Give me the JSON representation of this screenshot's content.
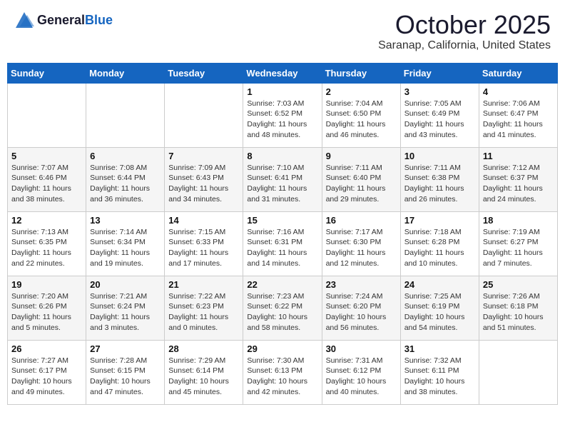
{
  "header": {
    "logo_general": "General",
    "logo_blue": "Blue",
    "month": "October 2025",
    "location": "Saranap, California, United States"
  },
  "weekdays": [
    "Sunday",
    "Monday",
    "Tuesday",
    "Wednesday",
    "Thursday",
    "Friday",
    "Saturday"
  ],
  "weeks": [
    [
      {
        "day": "",
        "info": ""
      },
      {
        "day": "",
        "info": ""
      },
      {
        "day": "",
        "info": ""
      },
      {
        "day": "1",
        "info": "Sunrise: 7:03 AM\nSunset: 6:52 PM\nDaylight: 11 hours\nand 48 minutes."
      },
      {
        "day": "2",
        "info": "Sunrise: 7:04 AM\nSunset: 6:50 PM\nDaylight: 11 hours\nand 46 minutes."
      },
      {
        "day": "3",
        "info": "Sunrise: 7:05 AM\nSunset: 6:49 PM\nDaylight: 11 hours\nand 43 minutes."
      },
      {
        "day": "4",
        "info": "Sunrise: 7:06 AM\nSunset: 6:47 PM\nDaylight: 11 hours\nand 41 minutes."
      }
    ],
    [
      {
        "day": "5",
        "info": "Sunrise: 7:07 AM\nSunset: 6:46 PM\nDaylight: 11 hours\nand 38 minutes."
      },
      {
        "day": "6",
        "info": "Sunrise: 7:08 AM\nSunset: 6:44 PM\nDaylight: 11 hours\nand 36 minutes."
      },
      {
        "day": "7",
        "info": "Sunrise: 7:09 AM\nSunset: 6:43 PM\nDaylight: 11 hours\nand 34 minutes."
      },
      {
        "day": "8",
        "info": "Sunrise: 7:10 AM\nSunset: 6:41 PM\nDaylight: 11 hours\nand 31 minutes."
      },
      {
        "day": "9",
        "info": "Sunrise: 7:11 AM\nSunset: 6:40 PM\nDaylight: 11 hours\nand 29 minutes."
      },
      {
        "day": "10",
        "info": "Sunrise: 7:11 AM\nSunset: 6:38 PM\nDaylight: 11 hours\nand 26 minutes."
      },
      {
        "day": "11",
        "info": "Sunrise: 7:12 AM\nSunset: 6:37 PM\nDaylight: 11 hours\nand 24 minutes."
      }
    ],
    [
      {
        "day": "12",
        "info": "Sunrise: 7:13 AM\nSunset: 6:35 PM\nDaylight: 11 hours\nand 22 minutes."
      },
      {
        "day": "13",
        "info": "Sunrise: 7:14 AM\nSunset: 6:34 PM\nDaylight: 11 hours\nand 19 minutes."
      },
      {
        "day": "14",
        "info": "Sunrise: 7:15 AM\nSunset: 6:33 PM\nDaylight: 11 hours\nand 17 minutes."
      },
      {
        "day": "15",
        "info": "Sunrise: 7:16 AM\nSunset: 6:31 PM\nDaylight: 11 hours\nand 14 minutes."
      },
      {
        "day": "16",
        "info": "Sunrise: 7:17 AM\nSunset: 6:30 PM\nDaylight: 11 hours\nand 12 minutes."
      },
      {
        "day": "17",
        "info": "Sunrise: 7:18 AM\nSunset: 6:28 PM\nDaylight: 11 hours\nand 10 minutes."
      },
      {
        "day": "18",
        "info": "Sunrise: 7:19 AM\nSunset: 6:27 PM\nDaylight: 11 hours\nand 7 minutes."
      }
    ],
    [
      {
        "day": "19",
        "info": "Sunrise: 7:20 AM\nSunset: 6:26 PM\nDaylight: 11 hours\nand 5 minutes."
      },
      {
        "day": "20",
        "info": "Sunrise: 7:21 AM\nSunset: 6:24 PM\nDaylight: 11 hours\nand 3 minutes."
      },
      {
        "day": "21",
        "info": "Sunrise: 7:22 AM\nSunset: 6:23 PM\nDaylight: 11 hours\nand 0 minutes."
      },
      {
        "day": "22",
        "info": "Sunrise: 7:23 AM\nSunset: 6:22 PM\nDaylight: 10 hours\nand 58 minutes."
      },
      {
        "day": "23",
        "info": "Sunrise: 7:24 AM\nSunset: 6:20 PM\nDaylight: 10 hours\nand 56 minutes."
      },
      {
        "day": "24",
        "info": "Sunrise: 7:25 AM\nSunset: 6:19 PM\nDaylight: 10 hours\nand 54 minutes."
      },
      {
        "day": "25",
        "info": "Sunrise: 7:26 AM\nSunset: 6:18 PM\nDaylight: 10 hours\nand 51 minutes."
      }
    ],
    [
      {
        "day": "26",
        "info": "Sunrise: 7:27 AM\nSunset: 6:17 PM\nDaylight: 10 hours\nand 49 minutes."
      },
      {
        "day": "27",
        "info": "Sunrise: 7:28 AM\nSunset: 6:15 PM\nDaylight: 10 hours\nand 47 minutes."
      },
      {
        "day": "28",
        "info": "Sunrise: 7:29 AM\nSunset: 6:14 PM\nDaylight: 10 hours\nand 45 minutes."
      },
      {
        "day": "29",
        "info": "Sunrise: 7:30 AM\nSunset: 6:13 PM\nDaylight: 10 hours\nand 42 minutes."
      },
      {
        "day": "30",
        "info": "Sunrise: 7:31 AM\nSunset: 6:12 PM\nDaylight: 10 hours\nand 40 minutes."
      },
      {
        "day": "31",
        "info": "Sunrise: 7:32 AM\nSunset: 6:11 PM\nDaylight: 10 hours\nand 38 minutes."
      },
      {
        "day": "",
        "info": ""
      }
    ]
  ]
}
